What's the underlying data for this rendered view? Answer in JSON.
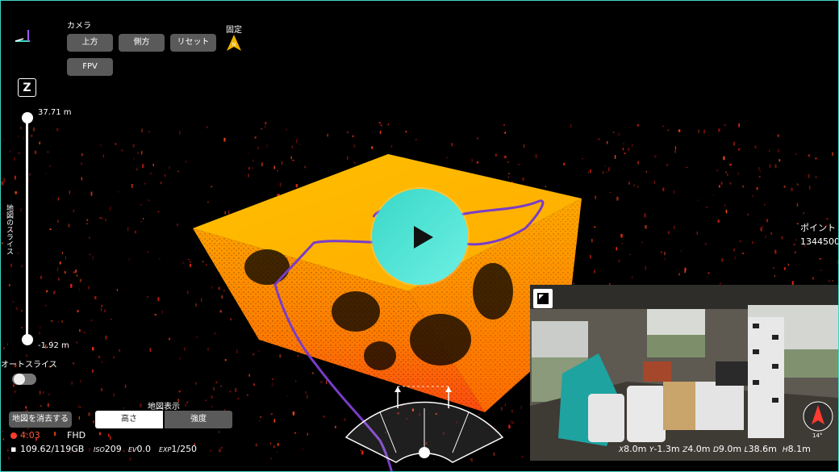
{
  "camera": {
    "title": "カメラ",
    "buttons": [
      "上方",
      "側方",
      "リセット"
    ],
    "fpv": "FPV",
    "fixed_label": "固定"
  },
  "z_slider": {
    "axis_label": "Z",
    "max_value": "37.71 m",
    "min_value": "-1.92 m",
    "vertical_label": "地図のスライス"
  },
  "auto_slice": {
    "label": "オートスライス",
    "enabled": false
  },
  "clear_map_button": "地図を消去する",
  "recording": {
    "time": "4:03",
    "quality": "FHD",
    "storage": "109.62/119GB",
    "iso_label": "ISO",
    "iso": "209",
    "ev_label": "EV",
    "ev": "0.0",
    "exp_label": "EXP",
    "exp": "1/250"
  },
  "map_display": {
    "title": "地図表示",
    "options": [
      "高さ",
      "強度"
    ],
    "selected": "高さ"
  },
  "point_count": {
    "label": "ポイント",
    "value": "1344500"
  },
  "camera_view": {
    "compass_angle": "14°",
    "stats": [
      {
        "axis": "X",
        "value": "8.0m"
      },
      {
        "axis": "Y",
        "value": "-1.3m"
      },
      {
        "axis": "Z",
        "value": "4.0m"
      },
      {
        "axis": "D",
        "value": "9.0m"
      },
      {
        "axis": "L",
        "value": "38.6m"
      },
      {
        "axis": "H",
        "value": "8.1m"
      }
    ]
  },
  "colors": {
    "accent": "#3fd6c2",
    "cloud_top": "#ffb400",
    "cloud_side": "#ff8c00",
    "cloud_ground": "#ff2a1a",
    "flight_path": "#7a3cc8",
    "record_dot": "#ff3b30"
  },
  "icons": {
    "axes": "axis-icon",
    "fixed": "compass-icon",
    "play": "play-icon",
    "expand": "expand-icon",
    "compass": "compass-arrow-icon"
  }
}
